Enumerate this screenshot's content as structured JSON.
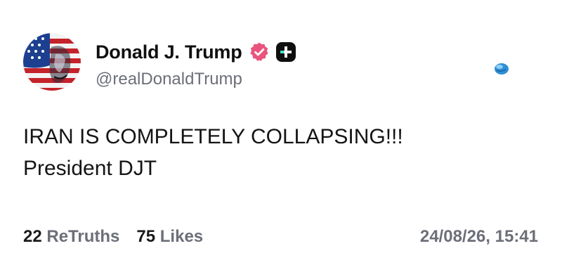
{
  "post": {
    "author": {
      "display_name": "Donald J. Trump",
      "handle": "@realDonaldTrump",
      "verified": true,
      "verified_icon": "verified-badge-icon",
      "plus_icon": "truth-plus-icon",
      "avatar_icon": "avatar-flag-portrait"
    },
    "visibility_icon": "globe-icon",
    "body_lines": [
      "IRAN IS COMPLETELY COLLAPSING!!!",
      "President DJT"
    ],
    "stats": {
      "retruths_count": "22",
      "retruths_label": "ReTruths",
      "likes_count": "75",
      "likes_label": "Likes"
    },
    "timestamp": "24/08/26, 15:41"
  },
  "colors": {
    "text_primary": "#0f0f0f",
    "text_secondary": "#6c6f78",
    "verified_pink": "#e9547d",
    "background": "#ffffff"
  }
}
